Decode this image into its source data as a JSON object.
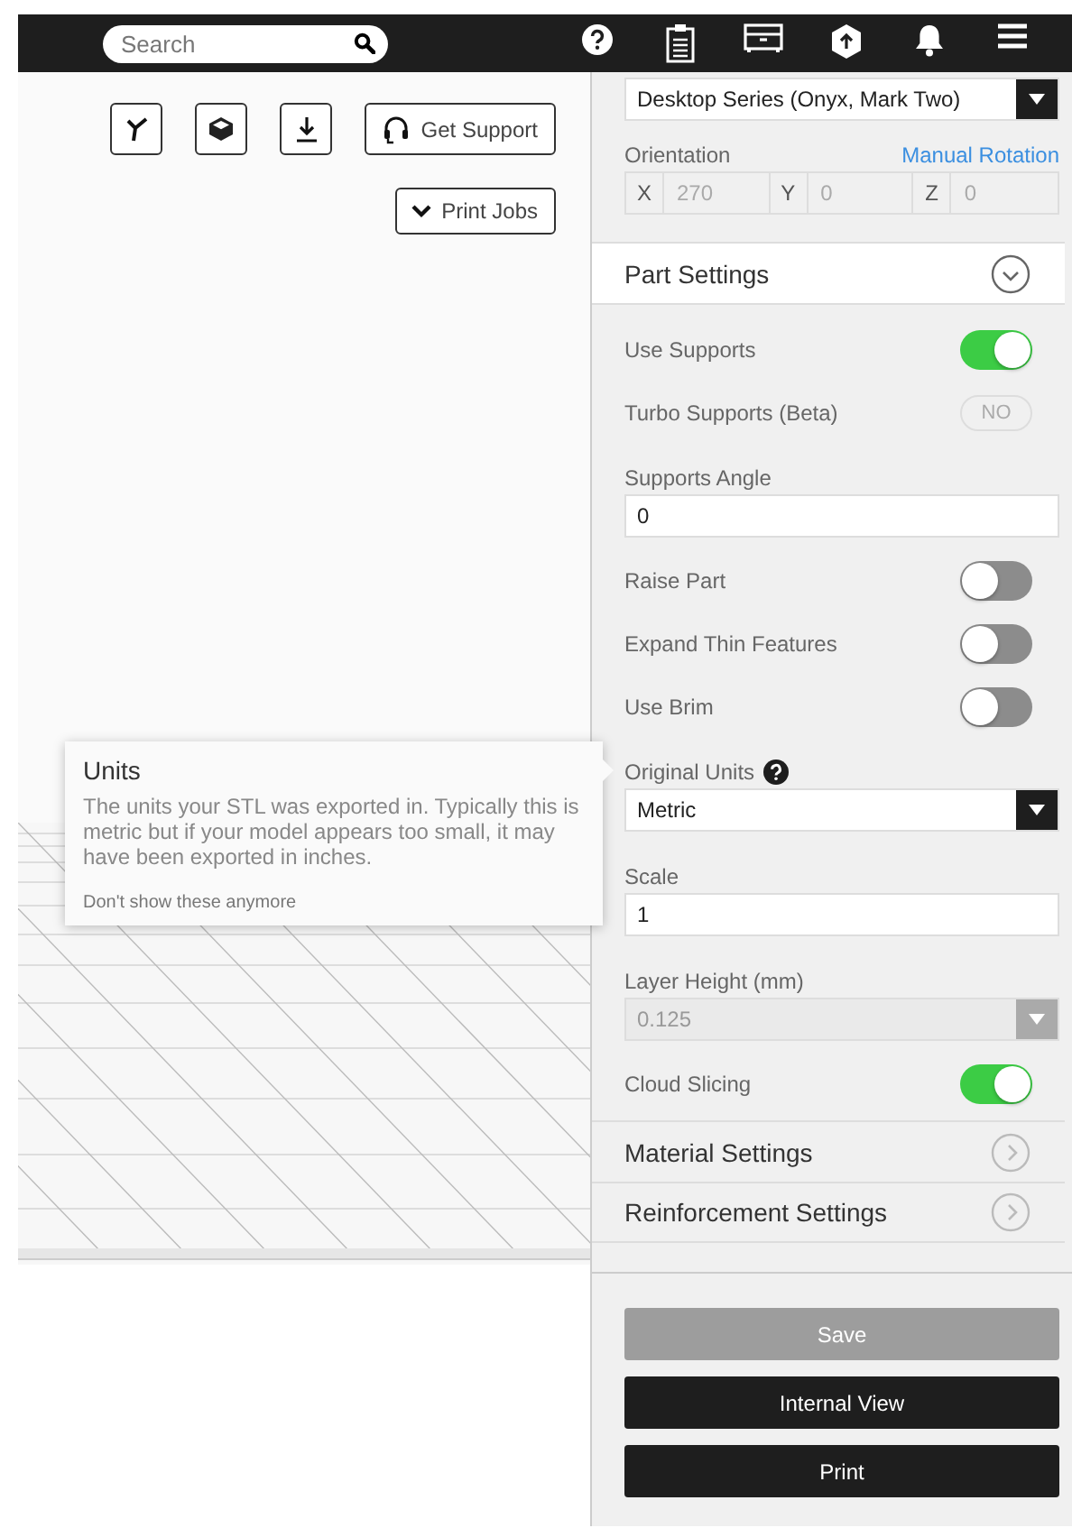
{
  "top_bar": {
    "search": {
      "placeholder": "Search"
    }
  },
  "viewport": {
    "get_support": "Get Support",
    "print_jobs": "Print Jobs"
  },
  "tooltip": {
    "title": "Units",
    "body": "The units your STL was exported in. Typically this is metric but if your model appears too small, it may have been exported in inches.",
    "dismiss": "Don't show these anymore"
  },
  "panel": {
    "printer": {
      "value": "Desktop Series (Onyx, Mark Two)"
    },
    "orientation": {
      "label": "Orientation",
      "link": "Manual Rotation",
      "axes": [
        {
          "axis": "X",
          "value": "270"
        },
        {
          "axis": "Y",
          "value": "0"
        },
        {
          "axis": "Z",
          "value": "0"
        }
      ]
    },
    "part_settings": {
      "title": "Part Settings",
      "expanded": true,
      "items": [
        {
          "kind": "toggle",
          "label": "Use Supports",
          "on": true
        },
        {
          "kind": "pill",
          "label": "Turbo Supports (Beta)",
          "value": "NO"
        },
        {
          "kind": "input",
          "label": "Supports Angle",
          "value": "0"
        },
        {
          "kind": "toggle",
          "label": "Raise Part",
          "on": false
        },
        {
          "kind": "toggle",
          "label": "Expand Thin Features",
          "on": false
        },
        {
          "kind": "toggle",
          "label": "Use Brim",
          "on": false
        },
        {
          "kind": "select",
          "label": "Original Units",
          "help": true,
          "value": "Metric",
          "disabled": false
        },
        {
          "kind": "input",
          "label": "Scale",
          "value": "1"
        },
        {
          "kind": "select",
          "label": "Layer Height (mm)",
          "help": false,
          "value": "0.125",
          "disabled": true
        },
        {
          "kind": "toggle",
          "label": "Cloud Slicing",
          "on": true
        }
      ]
    },
    "sections": [
      {
        "title": "Material Settings",
        "expanded": false
      },
      {
        "title": "Reinforcement Settings",
        "expanded": false
      }
    ],
    "buttons": [
      {
        "label": "Save",
        "disabled": true
      },
      {
        "label": "Internal View",
        "disabled": false
      },
      {
        "label": "Print",
        "disabled": false
      }
    ]
  }
}
